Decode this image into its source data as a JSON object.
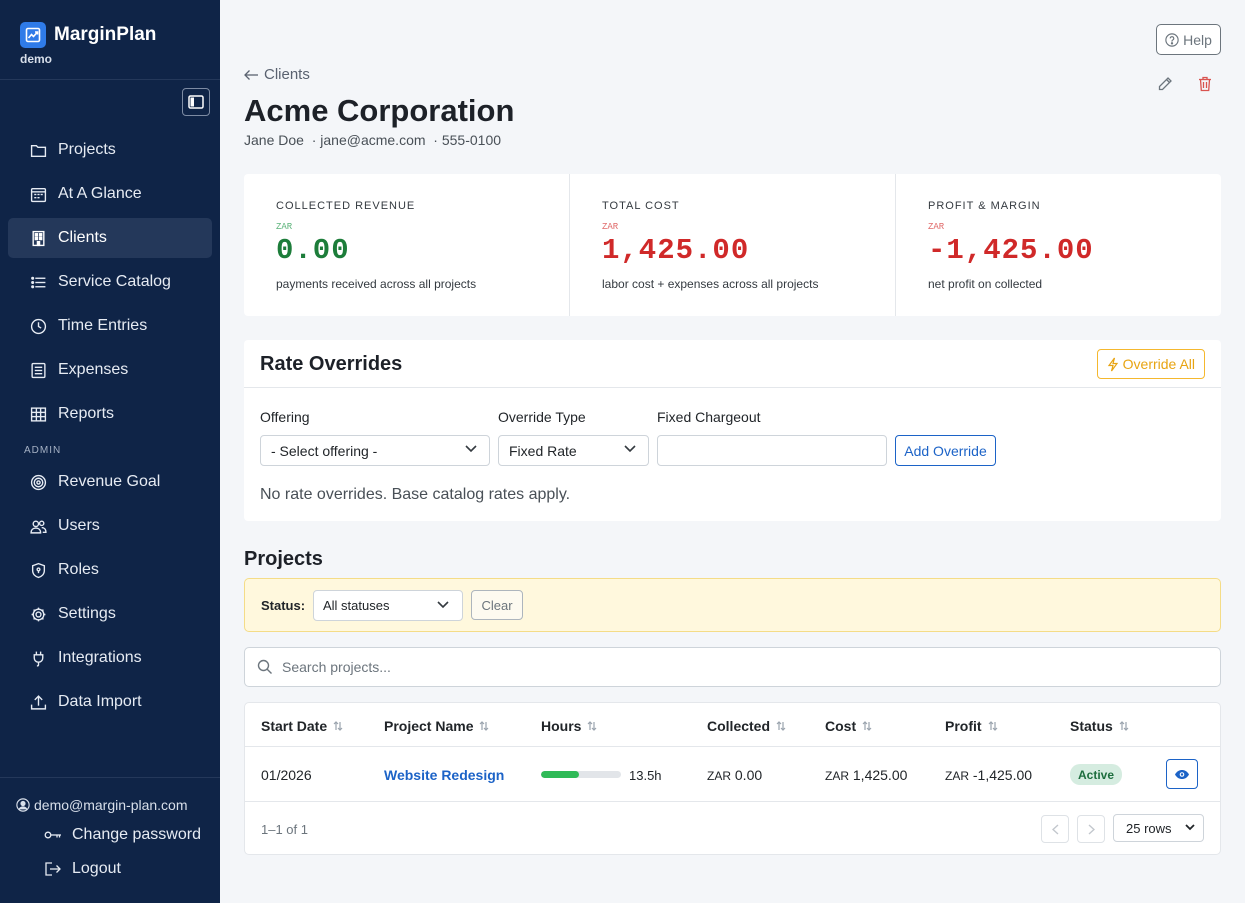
{
  "app": {
    "name": "MarginPlan",
    "workspace": "demo"
  },
  "sidebar": {
    "items": [
      {
        "label": "Projects",
        "icon": "folder-icon"
      },
      {
        "label": "At A Glance",
        "icon": "calendar-grid-icon"
      },
      {
        "label": "Clients",
        "icon": "building-icon",
        "active": true
      },
      {
        "label": "Service Catalog",
        "icon": "list-icon"
      },
      {
        "label": "Time Entries",
        "icon": "clock-icon"
      },
      {
        "label": "Expenses",
        "icon": "receipt-icon"
      },
      {
        "label": "Reports",
        "icon": "table-icon"
      }
    ],
    "admin_label": "ADMIN",
    "admin_items": [
      {
        "label": "Revenue Goal",
        "icon": "target-icon"
      },
      {
        "label": "Users",
        "icon": "users-icon"
      },
      {
        "label": "Roles",
        "icon": "shield-icon"
      },
      {
        "label": "Settings",
        "icon": "gear-icon"
      },
      {
        "label": "Integrations",
        "icon": "plug-icon"
      },
      {
        "label": "Data Import",
        "icon": "upload-icon"
      }
    ],
    "user_email": "demo@margin-plan.com",
    "change_password": "Change password",
    "logout": "Logout"
  },
  "header": {
    "help": "Help",
    "back": "Clients",
    "title": "Acme Corporation",
    "contact": "Jane Doe  · jane@acme.com  · 555-0100"
  },
  "stats": [
    {
      "label": "COLLECTED REVENUE",
      "currency": "ZAR",
      "value": "0.00",
      "desc": "payments received across all projects",
      "tone": "green"
    },
    {
      "label": "TOTAL COST",
      "currency": "ZAR",
      "value": "1,425.00",
      "desc": "labor cost + expenses across all projects",
      "tone": "red"
    },
    {
      "label": "PROFIT & MARGIN",
      "currency": "ZAR",
      "value": "-1,425.00",
      "desc": "net profit on collected",
      "tone": "red"
    }
  ],
  "rate_overrides": {
    "title": "Rate Overrides",
    "override_all": "Override All",
    "offering_label": "Offering",
    "offering_value": "- Select offering -",
    "type_label": "Override Type",
    "type_value": "Fixed Rate",
    "chargeout_label": "Fixed Chargeout",
    "chargeout_value": "",
    "add_button": "Add Override",
    "empty": "No rate overrides. Base catalog rates apply."
  },
  "projects": {
    "title": "Projects",
    "status_label": "Status:",
    "status_value": "All statuses",
    "clear": "Clear",
    "search_placeholder": "Search projects...",
    "columns": [
      "Start Date",
      "Project Name",
      "Hours",
      "Collected",
      "Cost",
      "Profit",
      "Status"
    ],
    "rows": [
      {
        "start_date": "01/2026",
        "name": "Website Redesign",
        "hours": "13.5h",
        "hours_progress": 0.48,
        "collected_cur": "ZAR",
        "collected": "0.00",
        "cost_cur": "ZAR",
        "cost": "1,425.00",
        "profit_cur": "ZAR",
        "profit": "-1,425.00",
        "status": "Active"
      }
    ],
    "pager_info": "1–1 of 1",
    "rows_per_page": "25 rows"
  },
  "colors": {
    "sidebar": "#0f2447",
    "accent": "#1c63c7",
    "positive": "#1d7d3a",
    "negative": "#d02929",
    "warning": "#e8a412"
  }
}
